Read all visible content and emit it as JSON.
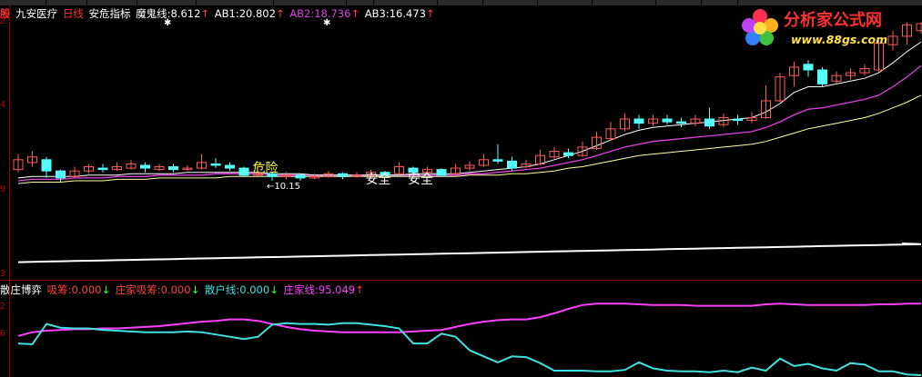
{
  "header": {
    "stock_icon": "股",
    "stock_name": "九安医疗",
    "period": "日线",
    "indicator_name": "安危指标",
    "mogui_label": "魔鬼线:",
    "mogui_value": "8.612",
    "mogui_arrow": "↑",
    "ab1_label": "AB1:",
    "ab1_value": "20.802",
    "ab1_arrow": "↑",
    "ab2_label": "AB2:",
    "ab2_value": "18.736",
    "ab2_arrow": "↑",
    "ab3_label": "AB3:",
    "ab3_value": "16.473",
    "ab3_arrow": "↑"
  },
  "sub_header": {
    "indicator_name": "散庄博弈",
    "xichou_label": "吸筹:",
    "xichou_value": "0.000",
    "xichou_arrow": "↓",
    "zhuang_xichou_label": "庄家吸筹:",
    "zhuang_xichou_value": "0.000",
    "zhuang_xichou_arrow": "↓",
    "sanhu_label": "散户线:",
    "sanhu_value": "0.000",
    "sanhu_arrow": "↓",
    "zhuang_label": "庄家线:",
    "zhuang_value": "95.049",
    "zhuang_arrow": "↑"
  },
  "logo": {
    "title": "分析家公式网",
    "url": "www.88gs.com"
  },
  "y_axis_labels": [
    "2",
    "4",
    "9",
    "3"
  ],
  "sub_y_axis_labels": [
    "2",
    "6"
  ],
  "colors": {
    "up": "#ff5a5a",
    "down": "#54ffff",
    "ab1": "#ffffff",
    "ab2": "#e040e0",
    "ab3": "#ffffa0",
    "long_ma": "#ffffff",
    "zhuang_line": "#ff40ff",
    "sanhu_line": "#40e0e0",
    "grid": "#8b0000"
  },
  "chart_data": [
    {
      "type": "candlestick",
      "price_range": [
        7.5,
        25.5
      ],
      "candles": [
        [
          15.1,
          15.8,
          16.2,
          14.9
        ],
        [
          15.6,
          16.0,
          16.4,
          15.3
        ],
        [
          15.8,
          15.0,
          16.0,
          14.5
        ],
        [
          15.0,
          14.5,
          15.1,
          14.2
        ],
        [
          14.6,
          15.0,
          15.3,
          14.5
        ],
        [
          15.0,
          15.3,
          15.5,
          14.8
        ],
        [
          15.2,
          15.1,
          15.5,
          14.9
        ],
        [
          15.1,
          15.3,
          15.6,
          15.0
        ],
        [
          15.2,
          15.5,
          15.8,
          15.1
        ],
        [
          15.4,
          15.2,
          15.6,
          14.9
        ],
        [
          15.1,
          15.3,
          15.5,
          15.0
        ],
        [
          15.3,
          15.1,
          15.5,
          14.9
        ],
        [
          15.1,
          15.2,
          15.4,
          15.0
        ],
        [
          15.2,
          15.6,
          16.2,
          15.1
        ],
        [
          15.5,
          15.4,
          15.9,
          15.2
        ],
        [
          15.4,
          15.2,
          15.6,
          15.0
        ],
        [
          15.2,
          14.7,
          15.3,
          14.6
        ],
        [
          14.7,
          14.8,
          15.0,
          14.6
        ],
        [
          14.8,
          14.6,
          14.9,
          14.3
        ],
        [
          14.6,
          14.7,
          14.9,
          14.4
        ],
        [
          14.7,
          14.5,
          14.8,
          14.3
        ],
        [
          14.5,
          14.6,
          14.8,
          14.4
        ],
        [
          14.6,
          14.8,
          15.0,
          14.5
        ],
        [
          14.8,
          14.6,
          14.9,
          14.4
        ],
        [
          14.6,
          14.7,
          14.9,
          14.5
        ],
        [
          14.7,
          14.9,
          15.1,
          14.6
        ],
        [
          14.9,
          14.7,
          15.0,
          14.6
        ],
        [
          14.8,
          15.3,
          15.6,
          14.7
        ],
        [
          15.2,
          14.9,
          15.3,
          14.7
        ],
        [
          14.9,
          15.1,
          15.3,
          14.8
        ],
        [
          15.1,
          14.7,
          15.2,
          14.6
        ],
        [
          14.8,
          15.2,
          15.5,
          14.7
        ],
        [
          15.2,
          15.4,
          15.7,
          15.0
        ],
        [
          15.4,
          15.8,
          16.2,
          15.3
        ],
        [
          15.8,
          15.7,
          16.9,
          15.5
        ],
        [
          15.7,
          15.2,
          16.0,
          15.0
        ],
        [
          15.3,
          15.5,
          15.8,
          15.2
        ],
        [
          15.5,
          16.1,
          16.5,
          15.4
        ],
        [
          16.0,
          16.4,
          16.7,
          15.8
        ],
        [
          16.3,
          16.1,
          16.6,
          15.9
        ],
        [
          16.1,
          16.7,
          17.1,
          16.0
        ],
        [
          16.6,
          17.4,
          17.8,
          16.5
        ],
        [
          17.3,
          18.0,
          18.5,
          17.2
        ],
        [
          18.0,
          18.7,
          19.1,
          17.8
        ],
        [
          18.7,
          18.4,
          19.0,
          18.0
        ],
        [
          18.4,
          18.7,
          19.0,
          18.2
        ],
        [
          18.7,
          18.5,
          19.0,
          18.3
        ],
        [
          18.5,
          18.4,
          18.8,
          18.1
        ],
        [
          18.4,
          18.7,
          19.0,
          18.2
        ],
        [
          18.7,
          18.2,
          19.5,
          18.0
        ],
        [
          18.3,
          18.8,
          19.1,
          18.1
        ],
        [
          18.7,
          18.6,
          19.0,
          18.3
        ],
        [
          18.6,
          18.8,
          19.2,
          18.4
        ],
        [
          18.8,
          20.0,
          21.1,
          18.7
        ],
        [
          20.0,
          21.7,
          22.0,
          19.9
        ],
        [
          21.8,
          22.4,
          22.8,
          21.0
        ],
        [
          22.6,
          22.2,
          22.9,
          21.7
        ],
        [
          22.2,
          21.2,
          22.4,
          21.0
        ],
        [
          21.4,
          21.8,
          22.1,
          21.2
        ],
        [
          21.8,
          22.0,
          22.3,
          21.5
        ],
        [
          22.0,
          22.3,
          22.6,
          21.8
        ],
        [
          22.2,
          24.1,
          24.3,
          22.0
        ],
        [
          24.0,
          24.6,
          25.0,
          23.6
        ],
        [
          24.6,
          25.4,
          25.6,
          24.0
        ],
        [
          25.0,
          25.5,
          25.6,
          24.8
        ]
      ],
      "ab1": [
        14.5,
        14.6,
        14.6,
        14.6,
        14.6,
        14.7,
        14.7,
        14.7,
        14.8,
        14.8,
        14.8,
        14.8,
        14.9,
        14.9,
        14.9,
        14.9,
        14.9,
        14.9,
        14.8,
        14.8,
        14.8,
        14.7,
        14.7,
        14.7,
        14.7,
        14.7,
        14.7,
        14.7,
        14.8,
        14.8,
        14.8,
        14.8,
        14.9,
        15.0,
        15.1,
        15.2,
        15.3,
        15.5,
        15.8,
        16.1,
        16.4,
        16.8,
        17.2,
        17.6,
        17.9,
        18.1,
        18.2,
        18.3,
        18.4,
        18.5,
        18.6,
        18.7,
        18.8,
        19.2,
        19.8,
        20.6,
        21.0,
        21.0,
        21.2,
        21.4,
        21.6,
        22.0,
        22.7,
        23.5,
        24.2
      ],
      "ab2": [
        14.3,
        14.4,
        14.4,
        14.4,
        14.5,
        14.5,
        14.5,
        14.6,
        14.6,
        14.6,
        14.7,
        14.7,
        14.7,
        14.7,
        14.8,
        14.8,
        14.8,
        14.8,
        14.7,
        14.7,
        14.7,
        14.7,
        14.7,
        14.7,
        14.7,
        14.7,
        14.7,
        14.7,
        14.7,
        14.7,
        14.7,
        14.7,
        14.8,
        14.8,
        14.9,
        15.0,
        15.1,
        15.2,
        15.4,
        15.6,
        15.8,
        16.1,
        16.4,
        16.7,
        16.9,
        17.1,
        17.2,
        17.3,
        17.4,
        17.5,
        17.6,
        17.7,
        17.8,
        18.1,
        18.5,
        19.0,
        19.4,
        19.5,
        19.7,
        19.9,
        20.1,
        20.4,
        21.0,
        21.7,
        22.5
      ],
      "ab3": [
        14.1,
        14.2,
        14.2,
        14.2,
        14.3,
        14.3,
        14.3,
        14.4,
        14.4,
        14.4,
        14.5,
        14.5,
        14.5,
        14.5,
        14.5,
        14.6,
        14.6,
        14.6,
        14.6,
        14.6,
        14.6,
        14.6,
        14.6,
        14.6,
        14.6,
        14.6,
        14.6,
        14.6,
        14.6,
        14.6,
        14.6,
        14.6,
        14.7,
        14.7,
        14.7,
        14.8,
        14.8,
        14.9,
        15.0,
        15.2,
        15.3,
        15.5,
        15.7,
        15.9,
        16.1,
        16.2,
        16.3,
        16.4,
        16.5,
        16.6,
        16.7,
        16.8,
        16.9,
        17.1,
        17.4,
        17.7,
        18.0,
        18.2,
        18.4,
        18.6,
        18.8,
        19.1,
        19.5,
        19.9,
        20.4
      ],
      "long_ma": [
        8.5,
        8.52,
        8.54,
        8.56,
        8.58,
        8.6,
        8.62,
        8.64,
        8.66,
        8.68,
        8.7,
        8.72,
        8.74,
        8.76,
        8.78,
        8.8,
        8.82,
        8.84,
        8.86,
        8.88,
        8.9,
        8.92,
        8.94,
        8.96,
        8.98,
        9.0,
        9.02,
        9.04,
        9.06,
        9.08,
        9.1,
        9.12,
        9.14,
        9.16,
        9.18,
        9.2,
        9.22,
        9.24,
        9.26,
        9.28,
        9.3,
        9.32,
        9.34,
        9.36,
        9.38,
        9.4,
        9.42,
        9.44,
        9.46,
        9.48,
        9.5,
        9.52,
        9.54,
        9.56,
        9.58,
        9.6,
        9.62,
        9.64,
        9.66,
        9.68,
        9.7,
        9.72,
        9.74,
        9.76,
        9.78
      ],
      "annotations": [
        {
          "text": "危险",
          "index": 17,
          "price": 14.9,
          "color": "#ffff40"
        },
        {
          "text": "←10.15",
          "index": 18,
          "price": 13.7,
          "color": "#ffffff"
        },
        {
          "text": "安全",
          "index": 25,
          "price": 14.1,
          "color": "#ffffff"
        },
        {
          "text": "安全",
          "index": 28,
          "price": 14.1,
          "color": "#ffffff"
        }
      ]
    },
    {
      "type": "line",
      "value_range": [
        0,
        100
      ],
      "series": [
        {
          "name": "庄家线",
          "key": "zhuang",
          "values": [
            52,
            57,
            59,
            60,
            61,
            61,
            62,
            62,
            63,
            64,
            65,
            67,
            69,
            71,
            72,
            74,
            74,
            72,
            68,
            64,
            61,
            59,
            58,
            57,
            57,
            57,
            57,
            57,
            58,
            59,
            60,
            64,
            68,
            71,
            73,
            74,
            74,
            77,
            82,
            88,
            93,
            95,
            95,
            95,
            94,
            93,
            93,
            93,
            92,
            92,
            92,
            92,
            92,
            94,
            95,
            94,
            93,
            93,
            93,
            93,
            93,
            94,
            94,
            95,
            95
          ]
        },
        {
          "name": "散户线",
          "key": "sanhu",
          "values": [
            42,
            41,
            68,
            63,
            62,
            62,
            60,
            59,
            58,
            57,
            57,
            57,
            58,
            57,
            54,
            51,
            48,
            51,
            67,
            69,
            68,
            68,
            67,
            69,
            69,
            67,
            65,
            62,
            42,
            42,
            55,
            51,
            33,
            25,
            17,
            25,
            24,
            16,
            6,
            6,
            6,
            5,
            5,
            7,
            17,
            9,
            6,
            5,
            5,
            4,
            6,
            4,
            10,
            6,
            22,
            12,
            15,
            9,
            6,
            16,
            14,
            5,
            5,
            1,
            0
          ]
        }
      ]
    }
  ]
}
